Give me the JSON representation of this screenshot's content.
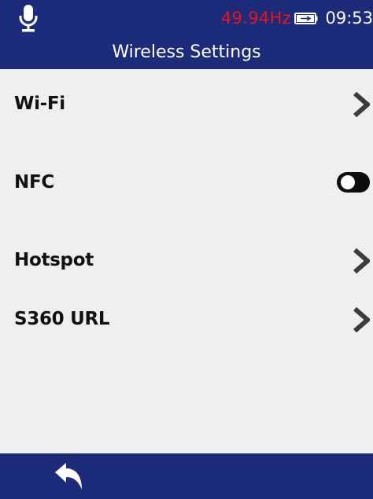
{
  "status": {
    "frequency": "49.94Hz",
    "frequency_color": "#e8141e",
    "battery_icon": "battery-charging-icon",
    "time": "09:53",
    "mic_icon": "microphone-icon"
  },
  "header": {
    "title": "Wireless Settings",
    "background_color": "#1c2b7a"
  },
  "menu": {
    "items": [
      {
        "label": "Wi-Fi",
        "control": "chevron-right-icon"
      },
      {
        "label": "NFC",
        "control": "toggle",
        "state": "off"
      },
      {
        "label": "Hotspot",
        "control": "chevron-right-icon"
      },
      {
        "label": "S360 URL",
        "control": "chevron-right-icon"
      }
    ]
  },
  "footer": {
    "back_icon": "back-arrow-icon"
  }
}
